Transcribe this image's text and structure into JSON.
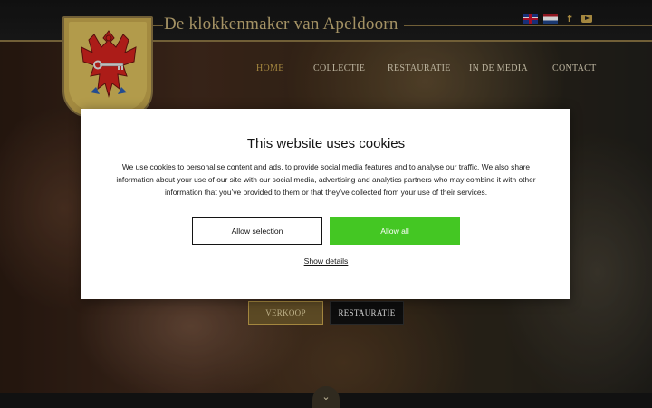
{
  "site": {
    "title": "De klokkenmaker van Apeldoorn"
  },
  "header": {
    "flags": [
      {
        "name": "english-flag-icon"
      },
      {
        "name": "dutch-flag-icon"
      }
    ],
    "social": {
      "facebook": "f",
      "youtube": "youtube-icon"
    }
  },
  "nav": {
    "items": [
      {
        "label": "HOME",
        "active": true
      },
      {
        "label": "COLLECTIE",
        "active": false
      },
      {
        "label": "RESTAURATIE",
        "active": false
      },
      {
        "label": "IN DE MEDIA",
        "active": false
      },
      {
        "label": "CONTACT",
        "active": false
      }
    ]
  },
  "hero": {
    "buttons": {
      "verkoop": "VERKOOP",
      "restauratie": "RESTAURATIE"
    },
    "scroll_icon": "chevron-down-icon"
  },
  "cookie_dialog": {
    "title": "This website uses cookies",
    "text": "We use cookies to personalise content and ads, to provide social media features and to analyse our traffic. We also share information about your use of our site with our social media, advertising and analytics partners who may combine it with other information that you’ve provided to them or that they’ve collected from your use of their services.",
    "allow_selection": "Allow selection",
    "allow_all": "Allow all",
    "show_details": "Show details"
  },
  "colors": {
    "gold": "#c9a54e",
    "allow_all_green": "#44c723",
    "crest_red": "#d2231e"
  }
}
